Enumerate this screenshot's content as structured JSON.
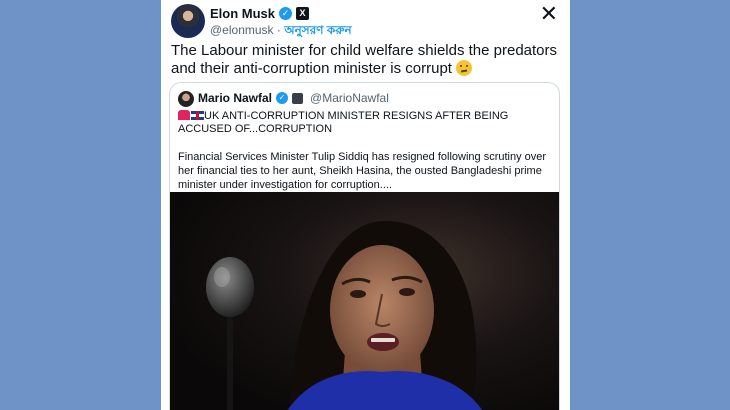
{
  "tweet": {
    "author_name": "Elon Musk",
    "handle": "@elonmusk",
    "separator": " · ",
    "follow_label": "অনুসরণ করুন",
    "text": "The Labour minister for child welfare shields the predators and their anti-corruption minister is corrupt",
    "close_label": "✕"
  },
  "quote": {
    "author_name": "Mario Nawfal",
    "handle": "@MarioNawfal",
    "headline": "UK ANTI-CORRUPTION MINISTER RESIGNS AFTER BEING ACCUSED OF...CORRUPTION",
    "body": "Financial Services Minister Tulip Siddiq has resigned following scrutiny over her financial ties to her aunt, Sheikh Hasina, the ousted Bangladeshi prime minister under investigation for corruption...."
  },
  "colors": {
    "background": "#6f93c6",
    "accent": "#1d9bf0",
    "text": "#0f1419",
    "muted": "#536471"
  }
}
